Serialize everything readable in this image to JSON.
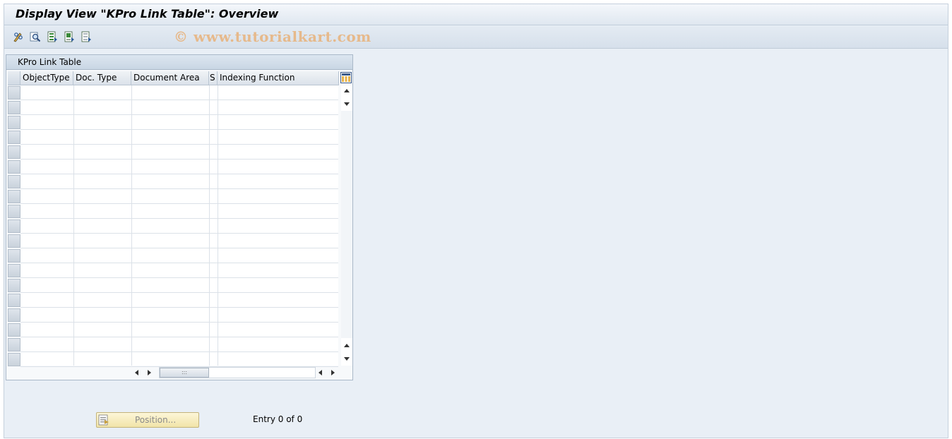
{
  "window": {
    "title": "Display View \"KPro Link Table\": Overview"
  },
  "watermark": "© www.tutorialkart.com",
  "toolbar": {
    "icons": [
      "change-display-icon",
      "find-icon",
      "select-all-icon",
      "select-block-icon",
      "deselect-all-icon"
    ]
  },
  "table": {
    "title": "KPro Link Table",
    "columns": [
      "ObjectType",
      "Doc. Type",
      "Document Area",
      "S",
      "Indexing Function"
    ],
    "rows": []
  },
  "footer": {
    "position_button": "Position...",
    "entry_text": "Entry 0 of 0"
  },
  "colors": {
    "background": "#e9eff6",
    "title_text": "#000000",
    "watermark": "#e8b27a",
    "button_face": "#f6ecbe"
  }
}
